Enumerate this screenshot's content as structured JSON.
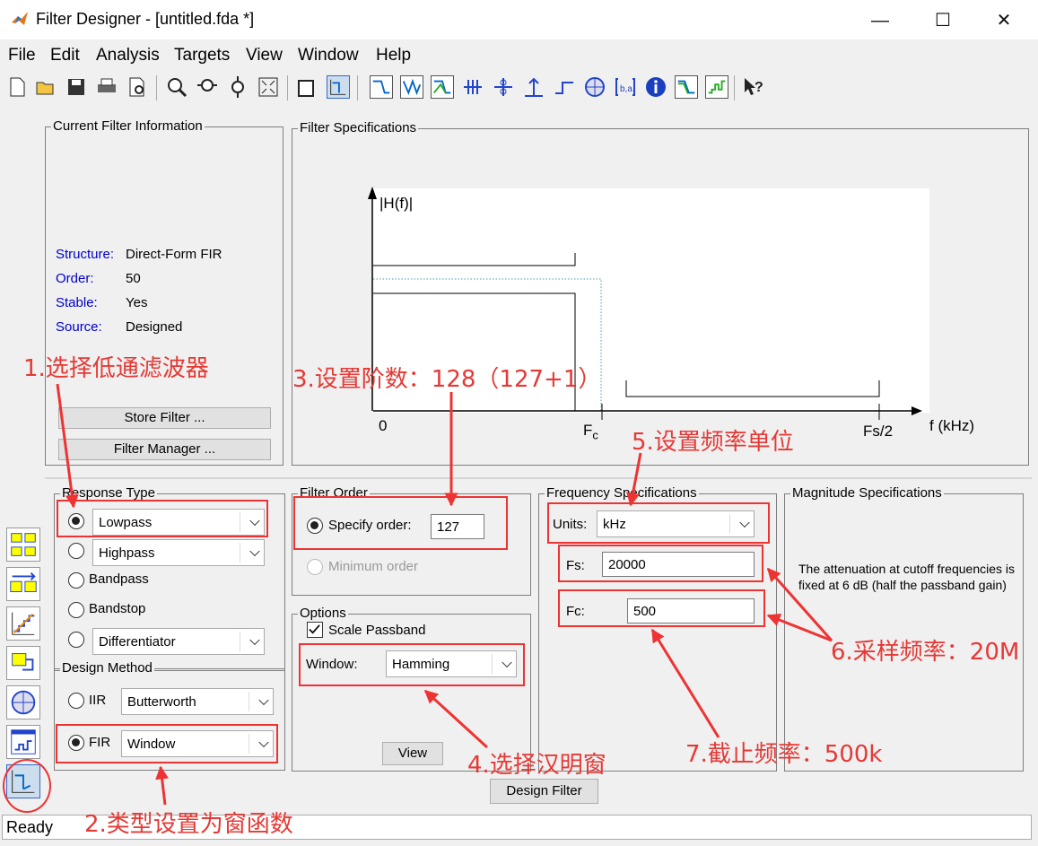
{
  "window": {
    "title": "Filter Designer -  [untitled.fda *]",
    "minimize": "—",
    "maximize": "☐",
    "close": "✕"
  },
  "menu": [
    "File",
    "Edit",
    "Analysis",
    "Targets",
    "View",
    "Window",
    "Help"
  ],
  "toolbar": {
    "icons": [
      "new-icon",
      "open-icon",
      "save-icon",
      "print-icon",
      "print-preview-icon",
      "zoom-in-icon",
      "zoom-x-icon",
      "zoom-y-icon",
      "full-view-icon",
      "new-figure-icon",
      "filter-spec-icon",
      "magnitude-response-icon",
      "phase-response-icon",
      "magnitude-phase-icon",
      "group-delay-icon",
      "phase-delay-icon",
      "impulse-response-icon",
      "step-response-icon",
      "pole-zero-icon",
      "coefficients-icon",
      "info-icon",
      "magnitude-estimate-icon",
      "round-off-noise-icon",
      "whats-this-icon"
    ]
  },
  "current_filter": {
    "title": "Current Filter Information",
    "rows": [
      {
        "key": "Structure:",
        "value": "Direct-Form FIR"
      },
      {
        "key": "Order:",
        "value": "50"
      },
      {
        "key": "Stable:",
        "value": "Yes"
      },
      {
        "key": "Source:",
        "value": "Designed"
      }
    ],
    "store_button": "Store Filter ...",
    "manager_button": "Filter Manager ..."
  },
  "filter_specs": {
    "title": "Filter Specifications",
    "y_label": "|H(f)|",
    "x_label": "f (kHz)",
    "origin": "0",
    "fc_label": "F",
    "fc_sub": "c",
    "fs2_label": "Fs/2"
  },
  "response_type": {
    "title": "Response Type",
    "lowpass": "Lowpass",
    "highpass": "Highpass",
    "bandpass": "Bandpass",
    "bandstop": "Bandstop",
    "differentiator": "Differentiator"
  },
  "design_method": {
    "title": "Design Method",
    "iir": "IIR",
    "iir_type": "Butterworth",
    "fir": "FIR",
    "fir_type": "Window"
  },
  "filter_order": {
    "title": "Filter Order",
    "specify": "Specify order:",
    "order_value": "127",
    "minimum": "Minimum order"
  },
  "options": {
    "title": "Options",
    "scale_passband": "Scale Passband",
    "window_label": "Window:",
    "window_value": "Hamming",
    "view_button": "View"
  },
  "frequency_specs": {
    "title": "Frequency Specifications",
    "units_label": "Units:",
    "units_value": "kHz",
    "fs_label": "Fs:",
    "fs_value": "20000",
    "fc_label": "Fc:",
    "fc_value": "500"
  },
  "magnitude_specs": {
    "title": "Magnitude Specifications",
    "note": "The attenuation at cutoff frequencies is fixed at 6 dB (half the passband gain)"
  },
  "design_button": "Design Filter",
  "status": "Ready",
  "annotations": {
    "a1": "1.选择低通滤波器",
    "a2": "2.类型设置为窗函数",
    "a3": "3.设置阶数：128（127+1）",
    "a4": "4.选择汉明窗",
    "a5": "5.设置频率单位",
    "a6": "6.采样频率：20M",
    "a7": "7.截止频率：500k"
  },
  "colors": {
    "annotation": "#e53935",
    "label_blue": "#0000cc"
  }
}
